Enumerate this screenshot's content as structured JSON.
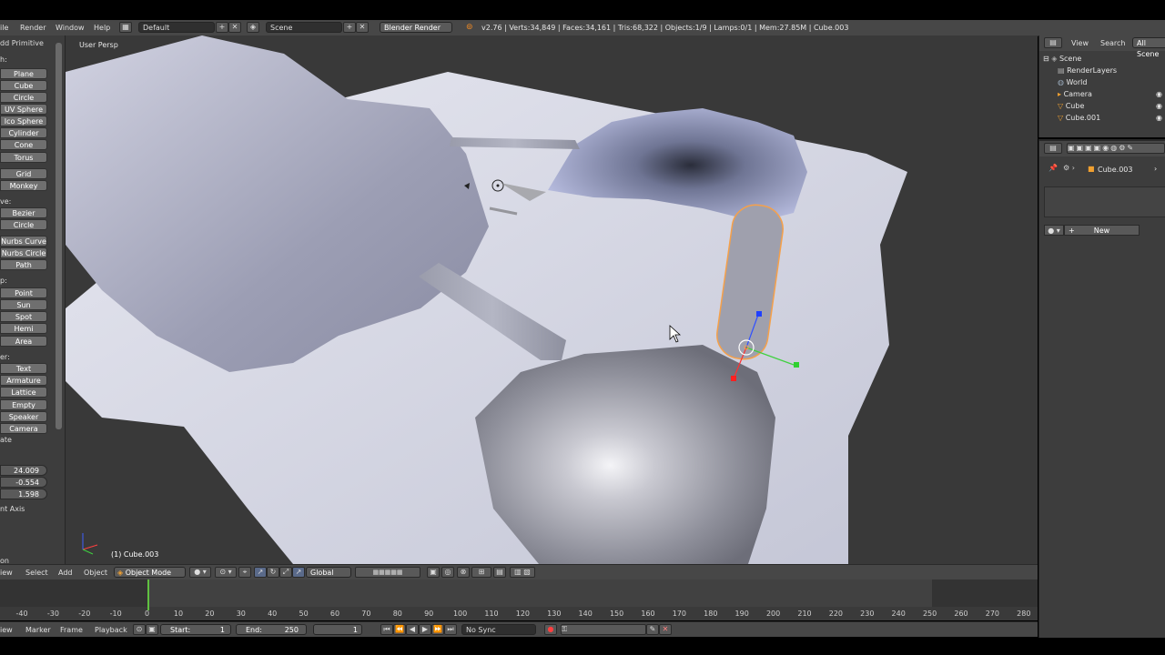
{
  "top": {
    "menus": [
      "ile",
      "Render",
      "Window",
      "Help"
    ],
    "layout": "Default",
    "scene": "Scene",
    "engine": "Blender Render",
    "stats": "v2.76 | Verts:34,849 | Faces:34,161 | Tris:68,322 | Objects:1/9 | Lamps:0/1 | Mem:27.85M | Cube.003"
  },
  "toolshelf": {
    "title": "dd Primitive",
    "mesh_label": "h:",
    "mesh": [
      "Plane",
      "Cube",
      "Circle",
      "UV Sphere",
      "Ico Sphere",
      "Cylinder",
      "Cone",
      "Torus"
    ],
    "mesh2": [
      "Grid",
      "Monkey"
    ],
    "curve_label": "ve:",
    "curve": [
      "Bezier",
      "Circle"
    ],
    "curve2": [
      "Nurbs Curve",
      "Nurbs Circle",
      "Path"
    ],
    "lamp_label": "p:",
    "lamp": [
      "Point",
      "Sun",
      "Spot",
      "Hemi",
      "Area"
    ],
    "other_label": "er:",
    "other": [
      "Text",
      "Armature",
      "Lattice",
      "Empty",
      "Speaker",
      "Camera"
    ],
    "rotate_label": "ate",
    "values": [
      "24.009",
      "-0.554",
      "1.598"
    ],
    "axis_label": "nt Axis",
    "on_label": "on"
  },
  "viewport": {
    "view_name": "User Persp",
    "object_name": "(1) Cube.003"
  },
  "vp_header": {
    "view": "iew",
    "select": "Select",
    "add": "Add",
    "object": "Object",
    "mode": "Object Mode",
    "orientation": "Global"
  },
  "timeline": {
    "ticks": [
      "-40",
      "-30",
      "-20",
      "-10",
      "0",
      "10",
      "20",
      "30",
      "40",
      "50",
      "60",
      "70",
      "80",
      "90",
      "100",
      "110",
      "120",
      "130",
      "140",
      "150",
      "160",
      "170",
      "180",
      "190",
      "200",
      "210",
      "220",
      "230",
      "240",
      "250",
      "260",
      "270",
      "280"
    ],
    "current_frame": 0
  },
  "tl_footer": {
    "view": "iew",
    "marker": "Marker",
    "frame": "Frame",
    "playback": "Playback",
    "start_label": "Start:",
    "start_value": "1",
    "end_label": "End:",
    "end_value": "250",
    "current": "1",
    "sync": "No Sync"
  },
  "outliner": {
    "view": "View",
    "search": "Search",
    "filter": "All Scene",
    "items": [
      "Scene",
      "RenderLayers",
      "World",
      "Camera",
      "Cube",
      "Cube.001"
    ]
  },
  "props": {
    "breadcrumb": "Cube.003",
    "new_button": "New"
  },
  "colors": {
    "header_bg": "#474747",
    "panel_bg": "#3d3d3d",
    "viewport_bg": "#393939",
    "selection_outline": "#f5a04a",
    "frame_cursor": "#60c040"
  }
}
